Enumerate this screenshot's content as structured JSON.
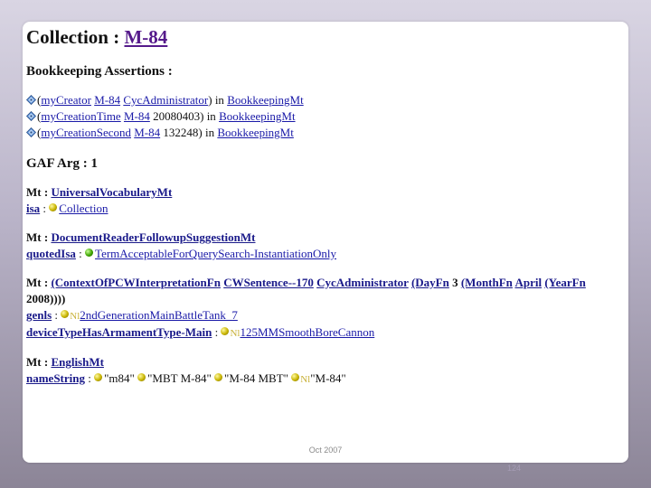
{
  "header": {
    "title_prefix": "Collection :",
    "title_link": "M-84"
  },
  "bookkeeping": {
    "heading": "Bookkeeping Assertions :",
    "rows": [
      {
        "open": "(",
        "pred": "myCreator",
        "arg1": "M-84",
        "arg2": "CycAdministrator",
        "close": ")",
        "in": "in",
        "mt": "BookkeepingMt",
        "plain": ""
      },
      {
        "open": "(",
        "pred": "myCreationTime",
        "arg1": "M-84",
        "arg2": "",
        "close": ")",
        "in": "in",
        "mt": "BookkeepingMt",
        "plain": "20080403"
      },
      {
        "open": "(",
        "pred": "myCreationSecond",
        "arg1": "M-84",
        "arg2": "",
        "close": ")",
        "in": "in",
        "mt": "BookkeepingMt",
        "plain": "132248"
      }
    ]
  },
  "gaf": {
    "heading": "GAF Arg : 1"
  },
  "mt1": {
    "label": "Mt :",
    "link": "UniversalVocabularyMt",
    "pred": "isa",
    "colon": ":",
    "value": "Collection"
  },
  "mt2": {
    "label": "Mt :",
    "link": "DocumentReaderFollowupSuggestionMt",
    "pred": "quotedIsa",
    "colon": ":",
    "value": "TermAcceptableForQuerySearch-InstantiationOnly"
  },
  "mt3": {
    "label": "Mt :",
    "ctx_link": "(ContextOfPCWInterpretationFn",
    "sent_link": "CWSentence--170",
    "admin_link": "CycAdministrator",
    "dayfn": "(DayFn",
    "three": "3",
    "monthfn": "(MonthFn",
    "april": "April",
    "yearfn": "(YearFn",
    "year_tail": "2008))))",
    "pred1": "genls",
    "colon": ":",
    "nl_marker": "Nl",
    "value1": "2ndGenerationMainBattleTank_7",
    "pred2": "deviceTypeHasArmamentType-Main",
    "value2": "125MMSmoothBoreCannon"
  },
  "mt4": {
    "label": "Mt :",
    "link": "EnglishMt",
    "pred": "nameString",
    "colon": ":",
    "values": [
      "\"m84\"",
      "\"MBT M-84\"",
      "\"M-84 MBT\"",
      "\"M-84\""
    ],
    "nl_marker": "Nl"
  },
  "footer": {
    "date": "Oct 2007",
    "page": "124"
  },
  "colors": {
    "link": "#1a1aa8",
    "title_link": "#551a8b",
    "background_top": "#d9d5e3",
    "background_bottom": "#8c8597"
  }
}
